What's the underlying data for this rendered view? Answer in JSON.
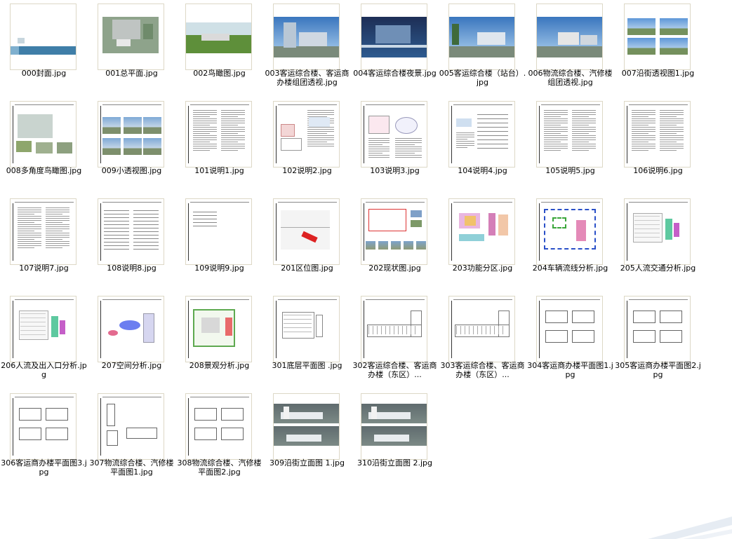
{
  "files": [
    {
      "name": "000封面.jpg",
      "kind": "cover"
    },
    {
      "name": "001总平面.jpg",
      "kind": "siteplan"
    },
    {
      "name": "002鸟瞰图.jpg",
      "kind": "aerial"
    },
    {
      "name": "003客运综合楼、客运商办楼组团透视.jpg",
      "kind": "render-sky"
    },
    {
      "name": "004客运综合楼夜景.jpg",
      "kind": "render-night"
    },
    {
      "name": "005客运综合楼（站台）.jpg",
      "kind": "render-sky2"
    },
    {
      "name": "006物流综合楼、汽修楼组团透视.jpg",
      "kind": "render-sky3"
    },
    {
      "name": "007沿街透视图1.jpg",
      "kind": "four-views"
    },
    {
      "name": "008多角度鸟瞰图.jpg",
      "kind": "multi-aerial"
    },
    {
      "name": "009小透视图.jpg",
      "kind": "small-views"
    },
    {
      "name": "101说明1.jpg",
      "kind": "text-page"
    },
    {
      "name": "102说明2.jpg",
      "kind": "text-diagram"
    },
    {
      "name": "103说明3.jpg",
      "kind": "text-diagram2"
    },
    {
      "name": "104说明4.jpg",
      "kind": "text-table"
    },
    {
      "name": "105说明5.jpg",
      "kind": "text-page"
    },
    {
      "name": "106说明6.jpg",
      "kind": "text-page"
    },
    {
      "name": "107说明7.jpg",
      "kind": "text-page"
    },
    {
      "name": "108说明8.jpg",
      "kind": "tables"
    },
    {
      "name": "109说明9.jpg",
      "kind": "table-small"
    },
    {
      "name": "201区位图.jpg",
      "kind": "location"
    },
    {
      "name": "202现状图.jpg",
      "kind": "photos"
    },
    {
      "name": "203功能分区.jpg",
      "kind": "zoning"
    },
    {
      "name": "204车辆流线分析.jpg",
      "kind": "traffic"
    },
    {
      "name": "205人流交通分析.jpg",
      "kind": "plan-color"
    },
    {
      "name": "206人流及出入口分析.jpg",
      "kind": "plan-color"
    },
    {
      "name": "207空间分析.jpg",
      "kind": "space"
    },
    {
      "name": "208景观分析.jpg",
      "kind": "landscape"
    },
    {
      "name": "301底层平面图 .jpg",
      "kind": "plan"
    },
    {
      "name": "302客运综合楼、客运商办楼（东区）...",
      "kind": "plan-long"
    },
    {
      "name": "303客运综合楼、客运商办楼（东区）...",
      "kind": "plan-long"
    },
    {
      "name": "304客运商办楼平面图1.jpg",
      "kind": "floorplans"
    },
    {
      "name": "305客运商办楼平面图2.jpg",
      "kind": "floorplans"
    },
    {
      "name": "306客运商办楼平面图3.jpg",
      "kind": "floorplans"
    },
    {
      "name": "307物流综合楼、汽修楼平面图1.jpg",
      "kind": "floorplans2"
    },
    {
      "name": "308物流综合楼、汽修楼平面图2.jpg",
      "kind": "floorplans"
    },
    {
      "name": "309沿街立面图 1.jpg",
      "kind": "elevation"
    },
    {
      "name": "310沿街立面图 2.jpg",
      "kind": "elevation"
    }
  ],
  "colors": {
    "thumb_border": "#ddd8c6",
    "sky": "#4a86c8",
    "night": "#1d2e55",
    "grass": "#5e8f3a",
    "elev_bg": "#5f6b6e"
  }
}
